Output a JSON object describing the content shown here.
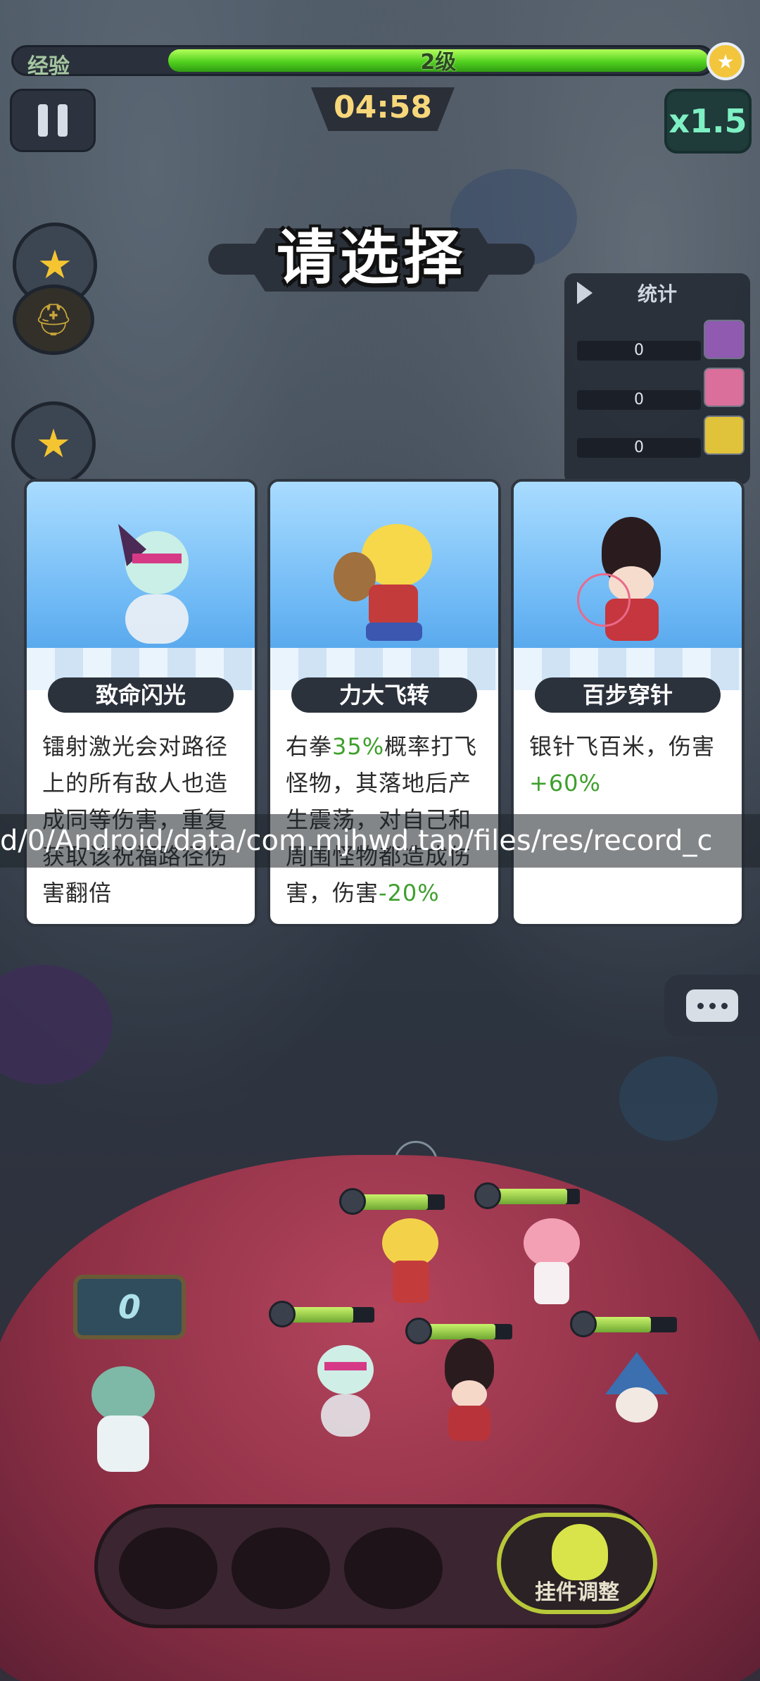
{
  "hud": {
    "xp_label": "经验",
    "level_text": "2级",
    "xp_progress": 0.95,
    "timer": "04:58",
    "speed": "x1.5"
  },
  "title": "请选择",
  "stats": {
    "title": "统计",
    "rows": [
      "0",
      "0",
      "0"
    ]
  },
  "cards": [
    {
      "name": "致命闪光",
      "desc_parts": [
        {
          "text": "镭射激光会对路径上的所有敌人也造成同等伤害，重复获取该祝福路径伤害翻倍",
          "color": ""
        }
      ]
    },
    {
      "name": "力大飞转",
      "desc_parts": [
        {
          "text": "右拳",
          "color": ""
        },
        {
          "text": "35%",
          "color": "green"
        },
        {
          "text": "概率打飞怪物，其落地后产生震荡，对自己和周围怪物都造成伤害，伤害",
          "color": ""
        },
        {
          "text": "-20%",
          "color": "green"
        }
      ]
    },
    {
      "name": "百步穿针",
      "desc_parts": [
        {
          "text": "银针飞百米，伤害",
          "color": ""
        },
        {
          "text": "+60%",
          "color": "green"
        }
      ]
    }
  ],
  "overlay_path": "d/0/Android/data/com.mjhwd.tap/files/res/record_c",
  "counter": "0",
  "plugin_button": "挂件调整",
  "colors": {
    "accent_green": "#3e9f2c",
    "xp_green": "#52d11f",
    "timer_yellow": "#f7d77a",
    "speed_teal": "#7ef0c3"
  },
  "icons": {
    "pause": "pause-icon",
    "chat": "chat-icon",
    "star_badge": "winged-star-icon",
    "stats_toggle": "play-triangle-icon"
  }
}
